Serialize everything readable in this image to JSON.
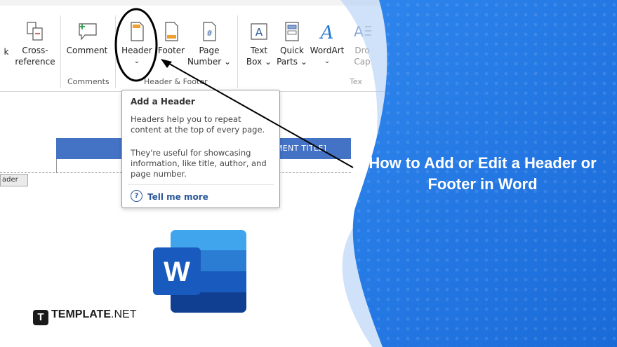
{
  "ribbon": {
    "buttons": [
      {
        "line1": "k",
        "line2": ""
      },
      {
        "line1": "Cross-",
        "line2": "reference"
      },
      {
        "line1": "Comment",
        "line2": ""
      },
      {
        "line1": "Header",
        "line2": "⌄"
      },
      {
        "line1": "Footer",
        "line2": ""
      },
      {
        "line1": "Page",
        "line2": "Number ⌄"
      },
      {
        "line1": "Text",
        "line2": "Box ⌄"
      },
      {
        "line1": "Quick",
        "line2": "Parts ⌄"
      },
      {
        "line1": "WordArt",
        "line2": "⌄"
      },
      {
        "line1": "Dro",
        "line2": "Cap"
      }
    ],
    "groups": {
      "comments": "Comments",
      "header_footer": "Header & Footer",
      "text": "Tex"
    }
  },
  "tooltip": {
    "title": "Add a Header",
    "p1": "Headers help you to repeat content at the top of every page.",
    "p2": "They're useful for showcasing information, like title, author, and page number.",
    "help_icon": "?",
    "more": "Tell me more"
  },
  "document": {
    "header_text": "MENT TITLE]",
    "header_tab": "ader"
  },
  "banner": {
    "title": "How to Add or Edit a Header or Footer in Word"
  },
  "logo": {
    "letter": "W"
  },
  "brand": {
    "mark": "T",
    "name_bold": "TEMPLATE",
    "name_rest": ".NET"
  },
  "colors": {
    "banner_blue": "#1b73e8",
    "word_blue": "#185abd",
    "header_bar": "#4472c4",
    "annotation": "#000000"
  }
}
